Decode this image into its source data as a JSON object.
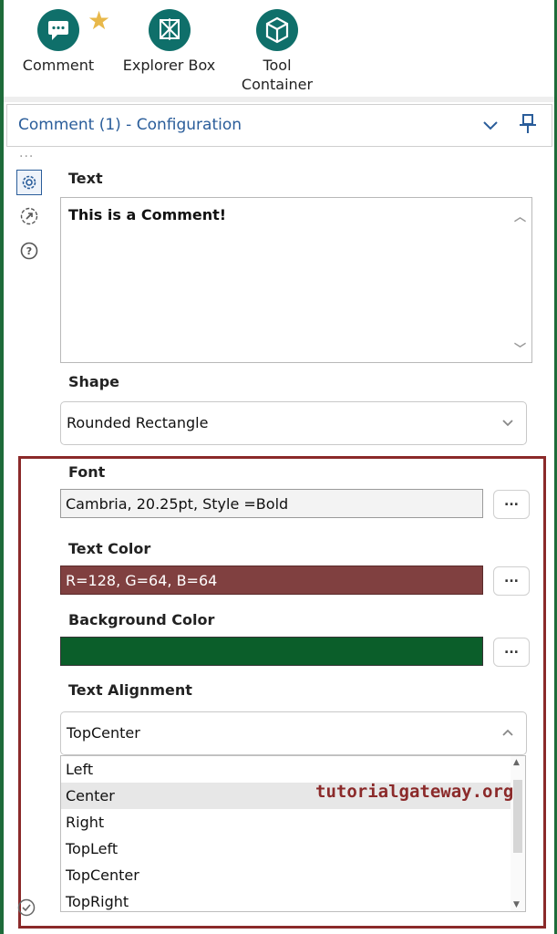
{
  "toolbar": {
    "comment_label": "Comment",
    "explorer_label": "Explorer Box",
    "tool_container_label_1": "Tool",
    "tool_container_label_2": "Container"
  },
  "header": {
    "title": "Comment (1) - Configuration"
  },
  "form": {
    "text_label": "Text",
    "text_value": "This is a Comment!",
    "shape_label": "Shape",
    "shape_value": "Rounded Rectangle",
    "font_label": "Font",
    "font_value": "Cambria, 20.25pt, Style =Bold",
    "text_color_label": "Text Color",
    "text_color_value": "R=128, G=64, B=64",
    "background_color_label": "Background Color",
    "background_color_value": "",
    "alignment_label": "Text Alignment",
    "alignment_value": "TopCenter",
    "alignment_options": [
      "Left",
      "Center",
      "Right",
      "TopLeft",
      "TopCenter",
      "TopRight"
    ],
    "browse_label": "..."
  },
  "watermark": "tutorialgateway.org",
  "colors": {
    "text_color": "#804040",
    "background_color": "#0b5e2a",
    "accent": "#2a5d9a",
    "icon_teal": "#0f6f6a",
    "annotation_border": "#8b2a2a"
  }
}
